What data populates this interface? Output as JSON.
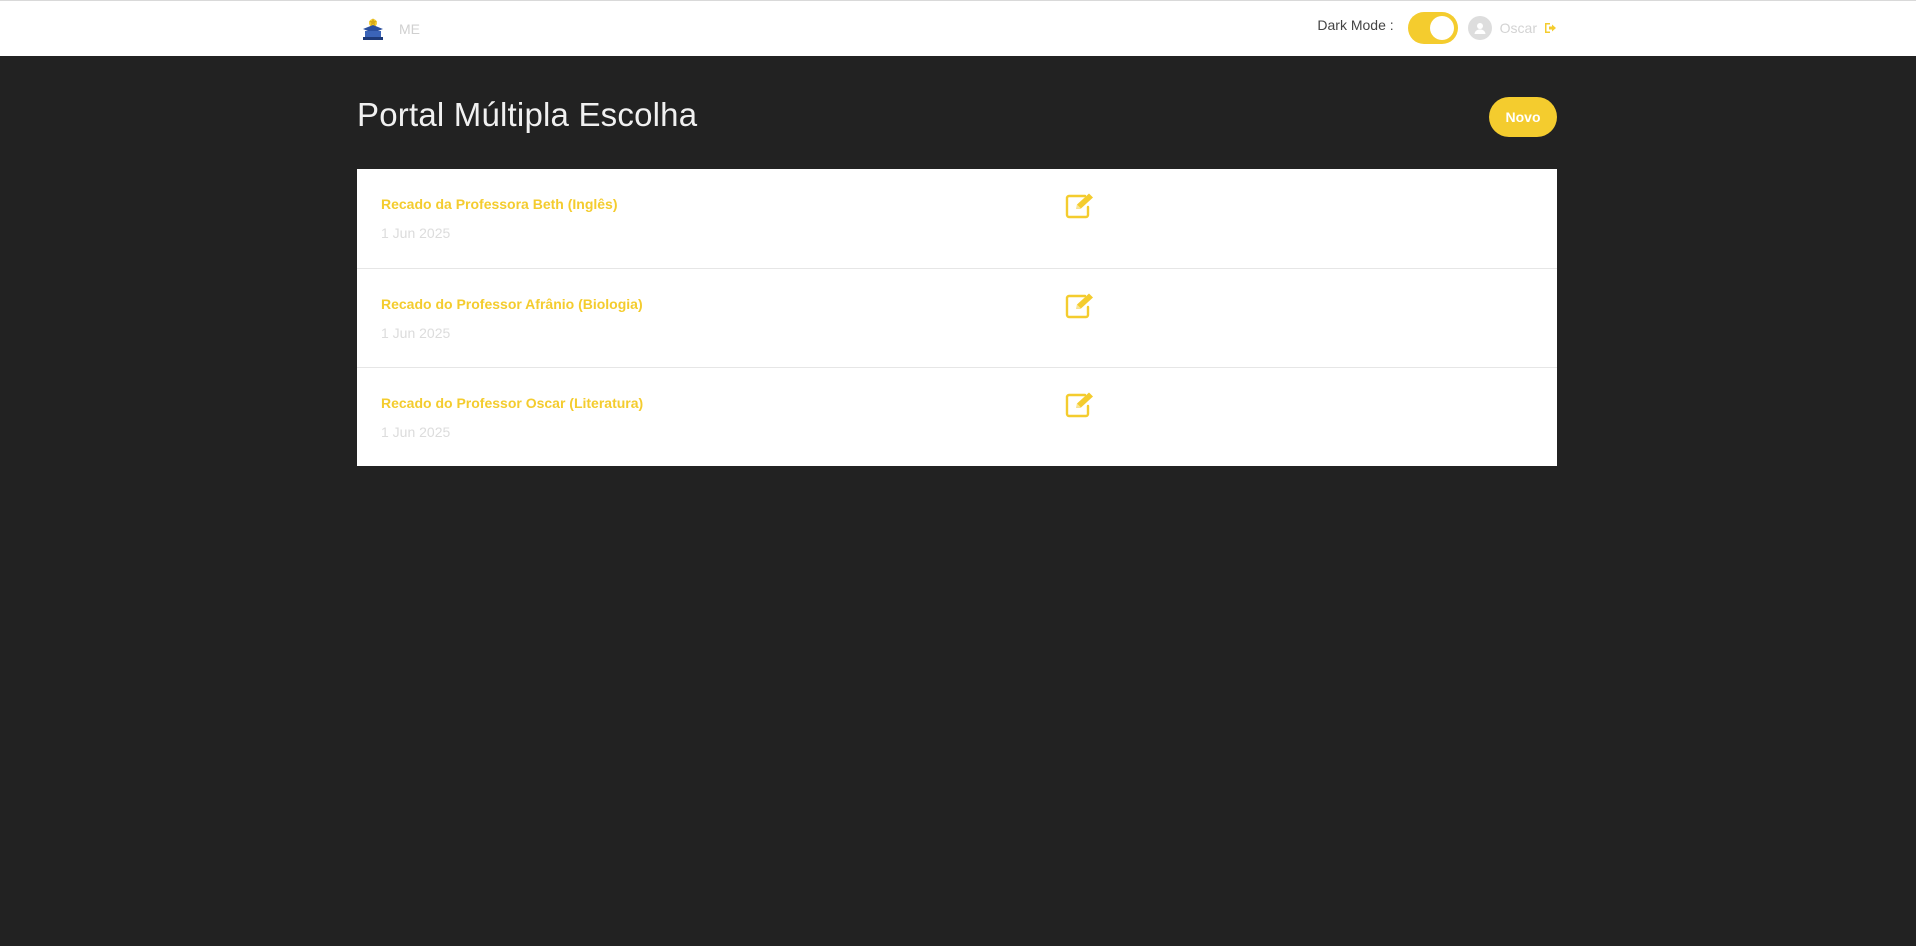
{
  "header": {
    "brand_text": "ME",
    "dark_mode_label": "Dark Mode :",
    "dark_mode_on": true,
    "user_name": "Oscar",
    "icons": {
      "logo": "school-logo-icon",
      "avatar": "user-avatar-icon",
      "logout": "logout-icon"
    }
  },
  "main": {
    "title": "Portal Múltipla Escolha",
    "new_button_label": "Novo",
    "items": [
      {
        "title": "Recado da Professora Beth (Inglês)",
        "date": "1 Jun 2025"
      },
      {
        "title": "Recado do Professor Afrânio (Biologia)",
        "date": "1 Jun 2025"
      },
      {
        "title": "Recado do Professor Oscar (Literatura)",
        "date": "1 Jun 2025"
      }
    ]
  },
  "colors": {
    "accent": "#f4cc2e",
    "background": "#222222",
    "card": "#ffffff"
  }
}
